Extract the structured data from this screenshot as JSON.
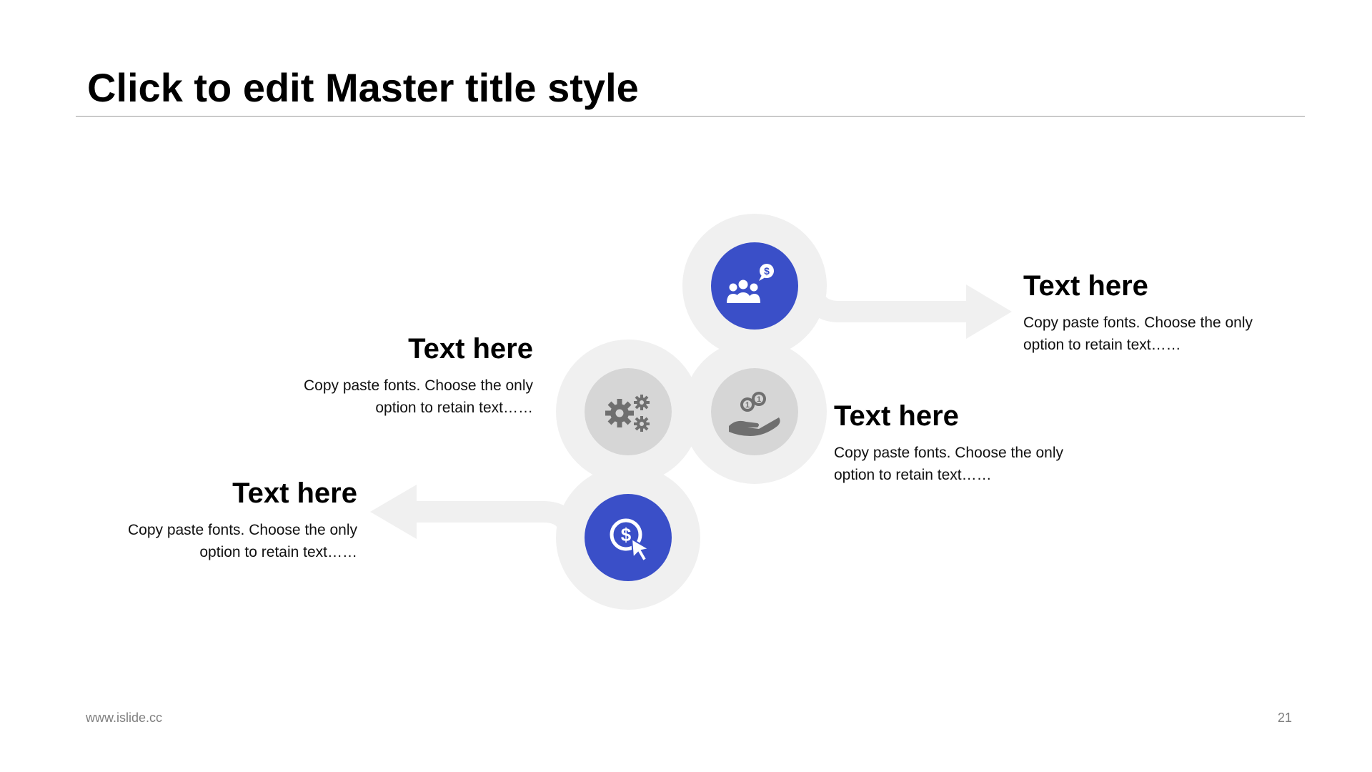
{
  "slide": {
    "title": "Click to edit Master title style",
    "footer_url": "www.islide.cc",
    "page_number": "21"
  },
  "colors": {
    "blue": "#3a4fc8",
    "grey_circle": "#d6d6d6",
    "grey_icon": "#6f6f6f",
    "path": "#f0f0f0"
  },
  "items": [
    {
      "heading": "Text here",
      "body_line1": "Copy paste fonts. Choose the only",
      "body_line2": "option to retain text……",
      "icon": "investor-group-dollar-icon",
      "style": "blue"
    },
    {
      "heading": "Text here",
      "body_line1": "Copy paste fonts. Choose the only",
      "body_line2": "option to retain text……",
      "icon": "gears-icon",
      "style": "grey"
    },
    {
      "heading": "Text here",
      "body_line1": "Copy paste fonts. Choose the only",
      "body_line2": "option to retain text……",
      "icon": "hand-coins-icon",
      "style": "grey"
    },
    {
      "heading": "Text here",
      "body_line1": "Copy paste fonts. Choose the only",
      "body_line2": "option to retain text……",
      "icon": "dollar-click-icon",
      "style": "blue"
    }
  ]
}
